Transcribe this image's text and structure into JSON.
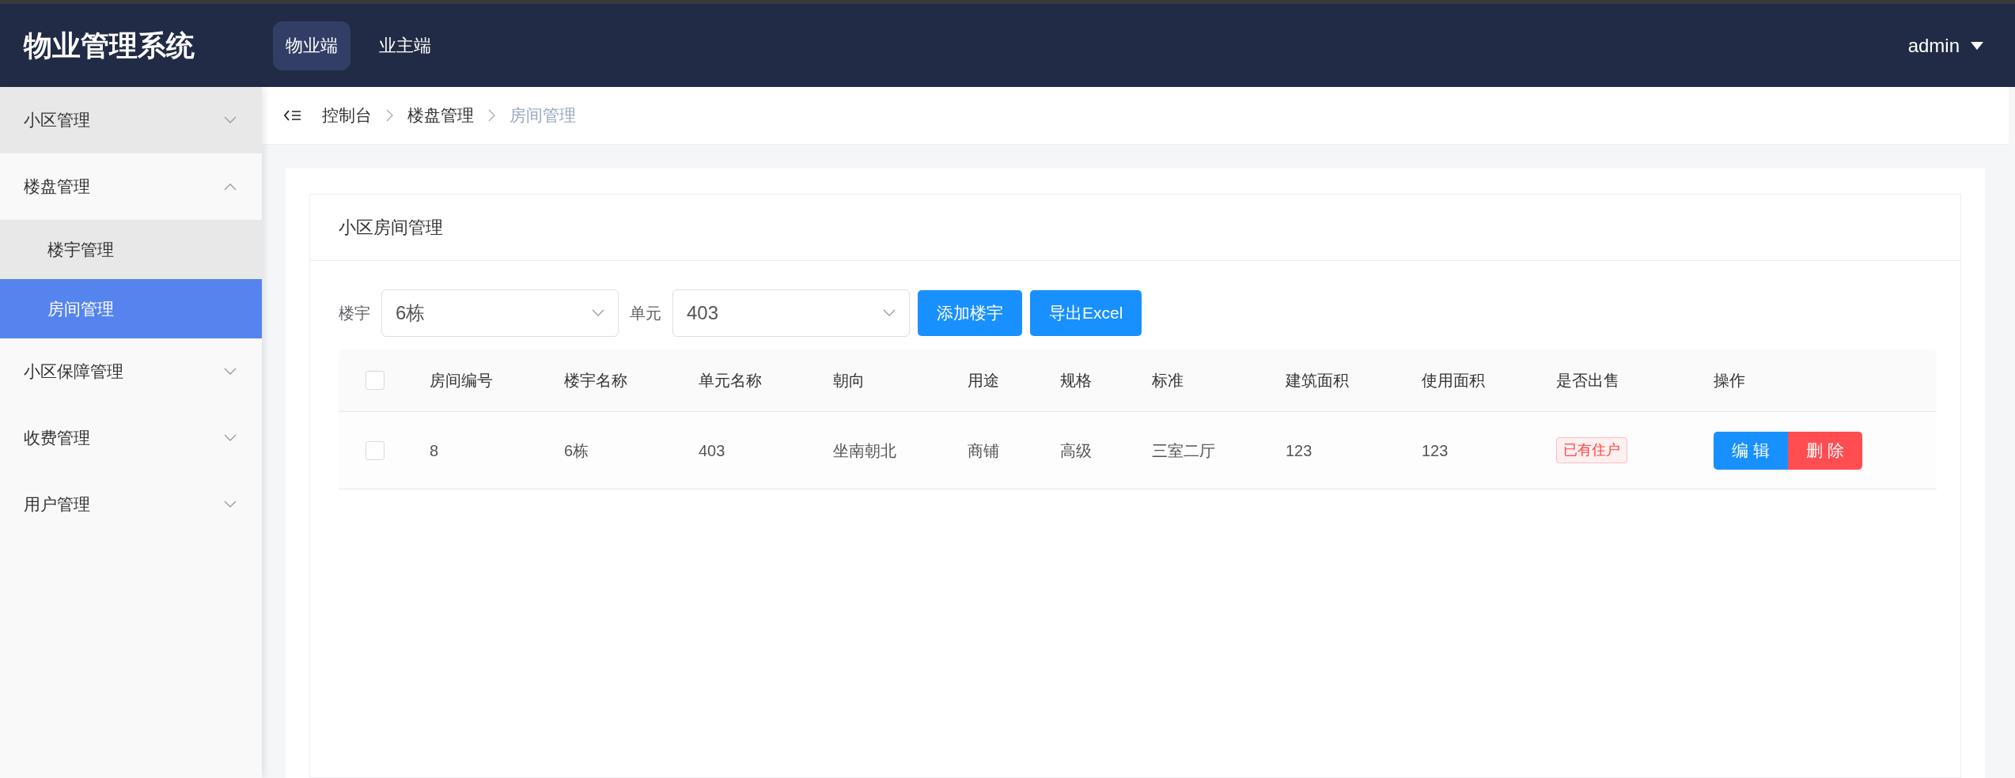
{
  "header": {
    "title": "物业管理系统",
    "tabs": [
      {
        "label": "物业端",
        "selected": true
      },
      {
        "label": "业主端",
        "selected": false
      }
    ],
    "user": "admin"
  },
  "sidebar": {
    "items": [
      {
        "label": "小区管理",
        "expanded": false,
        "highlighted": true
      },
      {
        "label": "楼盘管理",
        "expanded": true,
        "highlighted": false,
        "children": [
          {
            "label": "楼宇管理",
            "selected": false,
            "highlighted": true
          },
          {
            "label": "房间管理",
            "selected": true
          }
        ]
      },
      {
        "label": "小区保障管理",
        "expanded": false,
        "highlighted": false
      },
      {
        "label": "收费管理",
        "expanded": false,
        "highlighted": false
      },
      {
        "label": "用户管理",
        "expanded": false,
        "highlighted": false
      }
    ]
  },
  "breadcrumb": [
    "控制台",
    "楼盘管理",
    "房间管理"
  ],
  "card": {
    "title": "小区房间管理",
    "filters": [
      {
        "label": "楼宇",
        "value": "6栋"
      },
      {
        "label": "单元",
        "value": "403"
      }
    ],
    "buttons": [
      "添加楼宇",
      "导出Excel"
    ],
    "table": {
      "header_checked": false,
      "columns": [
        "房间编号",
        "楼宇名称",
        "单元名称",
        "朝向",
        "用途",
        "规格",
        "标准",
        "建筑面积",
        "使用面积",
        "是否出售",
        "操作"
      ],
      "rows": [
        {
          "checked": false,
          "cells": [
            "8",
            "6栋",
            "403",
            "坐南朝北",
            "商铺",
            "高级",
            "三室二厅",
            "123",
            "123"
          ],
          "status": "已有住户",
          "actions": [
            {
              "label": "编 辑",
              "kind": "edit"
            },
            {
              "label": "删 除",
              "kind": "delete"
            }
          ]
        }
      ]
    }
  }
}
